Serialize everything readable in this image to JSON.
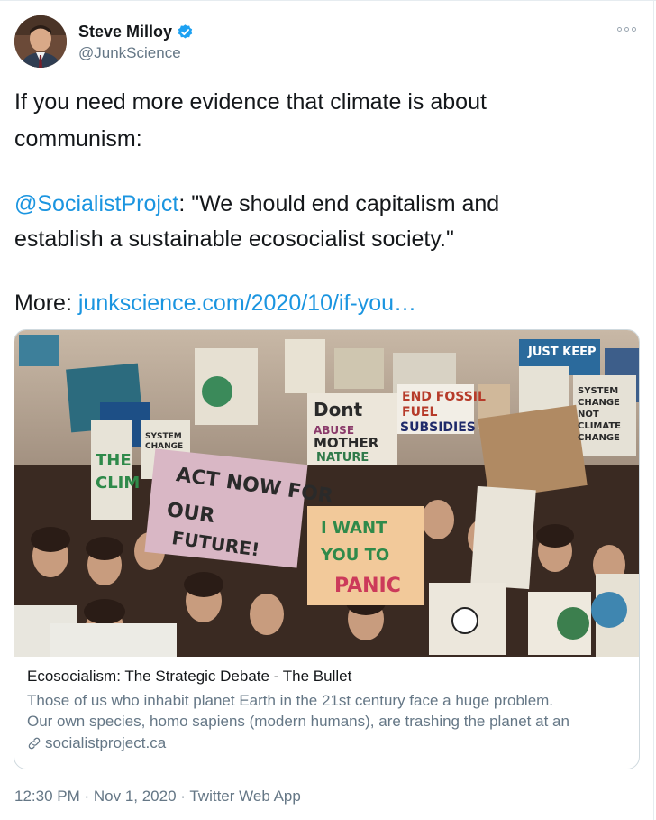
{
  "author": {
    "name": "Steve Milloy",
    "handle": "@JunkScience",
    "verified": true
  },
  "tweet": {
    "line1": "If you need more evidence that climate is about",
    "line2": "communism:",
    "mention": "@SocialistProjct",
    "quote_part1": ": \"We should end capitalism and",
    "quote_part2": "establish a sustainable ecosocialist society.\"",
    "more_label": "More: ",
    "url_text": "junkscience.com/2020/10/if-you…"
  },
  "card": {
    "title": "Ecosocialism: The Strategic Debate - The Bullet",
    "description_line1": "Those of us who inhabit planet Earth in the 21st century face a huge problem.",
    "description_line2": "Our own species, homo sapiens (modern humans), are trashing the planet at an",
    "domain": "socialistproject.ca",
    "image_signs": [
      "ACT NOW FOR OUR FUTURE!",
      "Dont ABUSE MOTHER NATURE",
      "END FOSSIL FUEL SUBSIDIES",
      "I WANT YOU TO PANIC",
      "SYSTEM CHANGE NOT CLIMATE CHANGE",
      "JUST KEEP",
      "THE CLIM"
    ]
  },
  "meta": {
    "timestamp": "12:30 PM · Nov 1, 2020 · Twitter Web App"
  },
  "colors": {
    "link": "#1b95e0",
    "verified": "#1da1f2",
    "secondary_text": "#657786"
  },
  "icons": [
    "verified-badge-icon",
    "more-options-icon",
    "link-icon"
  ]
}
